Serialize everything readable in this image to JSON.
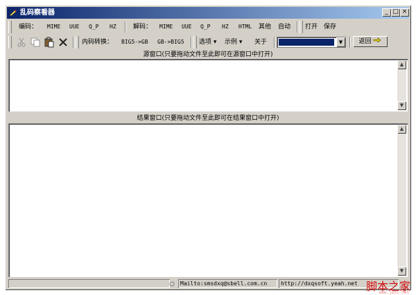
{
  "window": {
    "title": "乱码察看器",
    "caption_min": "_",
    "caption_max": "□",
    "caption_close": "×"
  },
  "toolbar1": {
    "encode_label": "编码：",
    "encode_items": [
      "MIME",
      "UUE",
      "Q_P",
      "HZ"
    ],
    "decode_label": "解码：",
    "decode_items": [
      "MIME",
      "UUE",
      "Q_P",
      "HZ",
      "HTML",
      "其他",
      "自动"
    ],
    "open": "打开",
    "save": "保存"
  },
  "toolbar2": {
    "convert_label": "内码转换：",
    "big5_to_gb": "BIG5->GB",
    "gb_to_big5": "GB->BIG5",
    "options": "选项",
    "examples": "示例",
    "about": "关于",
    "back": "返回"
  },
  "source": {
    "label": "源窗口(只要拖动文件至此即可在源窗口中打开)"
  },
  "result": {
    "label": "结果窗口(只要拖动文件至此即可在结果窗口中打开)"
  },
  "statusbar": {
    "mailto": "Mailto:smsdxq@sbell.com.cn",
    "url": "http://dxqsoft.yeah.net"
  },
  "watermark": {
    "text": "脚本之家",
    "url": "www.jb51.net"
  },
  "colors": {
    "titlebar_start": "#0a246a",
    "titlebar_end": "#a6caf0",
    "face": "#d4d0c8"
  }
}
